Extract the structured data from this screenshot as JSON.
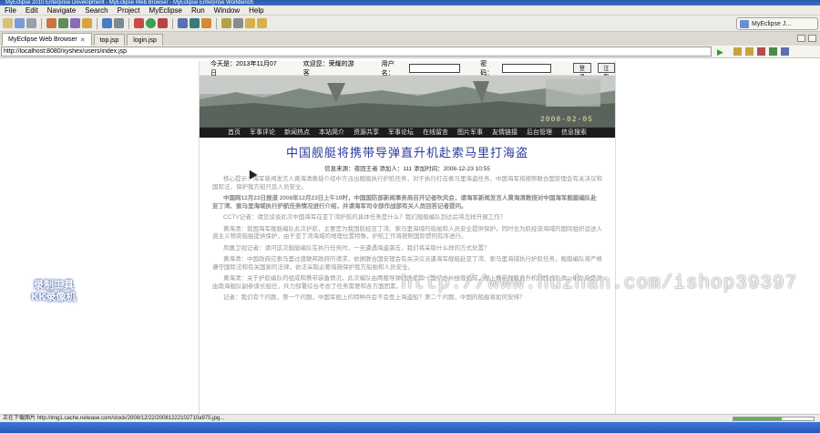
{
  "window": {
    "title": "MyEclipse 2010 Enterprise Development - MyEclipse Web Browser - MyEclipse Enterprise Workbench"
  },
  "menu": [
    "File",
    "Edit",
    "Navigate",
    "Search",
    "Project",
    "MyEclipse",
    "Run",
    "Window",
    "Help"
  ],
  "perspective": {
    "label": "MyEclipse J..."
  },
  "tabs": [
    {
      "label": "MyEclipse Web Browser",
      "active": true
    },
    {
      "label": "top.jsp",
      "active": false
    },
    {
      "label": "login.jsp",
      "active": false
    }
  ],
  "address": {
    "url": "http://localhost:8080/xyshex/users/index.jsp"
  },
  "site": {
    "topbar": {
      "today_label": "今天是：2013年11月07日",
      "welcome": "欢迎您：荣耀的游客",
      "user_label": "用户名：",
      "pwd_label": "密码：",
      "login": "登录",
      "register": "注册"
    },
    "banner_date": "2008-02-05",
    "nav": [
      "首页",
      "军事评论",
      "新闻热点",
      "本站简介",
      "资源共享",
      "军事论坛",
      "在线留言",
      "图片军事",
      "友情链接",
      "后台管理",
      "信息搜索"
    ],
    "article": {
      "title": "中国舰艇将携带导弹直升机赴索马里打海盗",
      "meta": "信息来源：夜回王者  添加人：111  添加时间：2008-12-23 10:55",
      "paragraphs": [
        "核心提示：海军新闻发言人黄海清教授介绍中方派出舰艇执行护航任务，对于执行打击索马里海盗任务，中国海军将按照联合国安理会有关决议和国际法，保护我方船只及人员安全。",
        "中国网12月23日报道 2008年12月23日上午10时，中国国防部新闻事务局召开记者吹风会，请海军新闻发言人黄海清教授对中国海军舰艇编队赴亚丁湾、索马里海域执行护航任务情况进行介绍，并请海军司令部作战部有关人员回答记者提问。",
        "CCTV记者：请您谈谈此次中国海军在亚丁湾护航的具体任务是什么？我们舰艇编队到达后将怎样开展工作？",
        "黄海清：我国海军舰艇编队此次护航，主要是为我国航经亚丁湾、索马里海域的船舶和人员安全提供保护，同时也为航经该海域的国际组织运送人道主义物资船舶提供保护，由于亚丁湾海域的地理位置特殊，护航工作将按照国际惯例有序进行。",
        "凤凰卫视记者：请问这次舰艇编队在执行任务时，一旦遭遇海盗袭击，我们将采取什么样的方式处置？",
        "黄海清：中国政府应索马里过渡联邦政府的请求，依据联合国安理会有关决议派遣海军舰艇赴亚丁湾、索马里海域执行护航任务，舰艇编队将严格遵守国际法和有关国家的法律，依法采取必要措施保护我方船舶和人员安全。",
        "黄海清：关于护航编队的组成和携带装备情况，此次编队由两艘导弹驱逐舰和一艘综合补给舰组成，舰上携带舰载直升机和特战队员，编队指挥员由南海舰队副参谋长担任，兵力部署综合考虑了任务需要和各方面因素。",
        "记者：我们有个问题，第一个问题，中国军舰上的特种兵会不会登上海盗船？第二个问题，中国的船舶将如何安排？"
      ]
    }
  },
  "overlays": {
    "watermark": "http://www.huzhan.com/ishop39397",
    "recorder_logo": [
      "录制工具",
      "KK录像机"
    ]
  },
  "status": {
    "text": "正在下载图片 http://img1.cache.netease.com/stock/2008/12/22/20081222102710a975.jpg...",
    "progress": 0.6
  },
  "colors": {
    "accent": "#2b3a9c",
    "navbar_bg": "#1d1d1d",
    "chrome_bg": "#ecebe5"
  }
}
